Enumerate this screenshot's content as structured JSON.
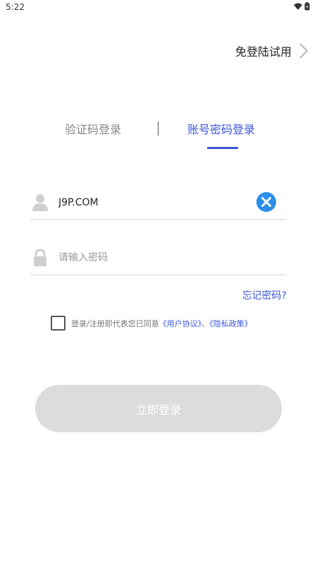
{
  "status_bar": {
    "time": "5:22",
    "icons": [
      "wifi-icon",
      "battery-icon"
    ]
  },
  "header": {
    "trial_label": "免登陆试用"
  },
  "tabs": [
    {
      "label": "验证码登录",
      "active": false
    },
    {
      "label": "账号密码登录",
      "active": true
    }
  ],
  "form": {
    "username_value": "J9P.COM",
    "password_placeholder": "请输入密码",
    "forgot_label": "忘记密码?"
  },
  "agreement": {
    "prefix": "登录/注册即代表您已同意",
    "user_agreement": "《用户协议》",
    "separator": "、",
    "privacy_policy": "《隐私政策》"
  },
  "login_button": {
    "label": "立即登录"
  },
  "colors": {
    "accent": "#3b57d6",
    "clear_button": "#2b8ee8",
    "disabled_button": "#dcdcdc"
  }
}
